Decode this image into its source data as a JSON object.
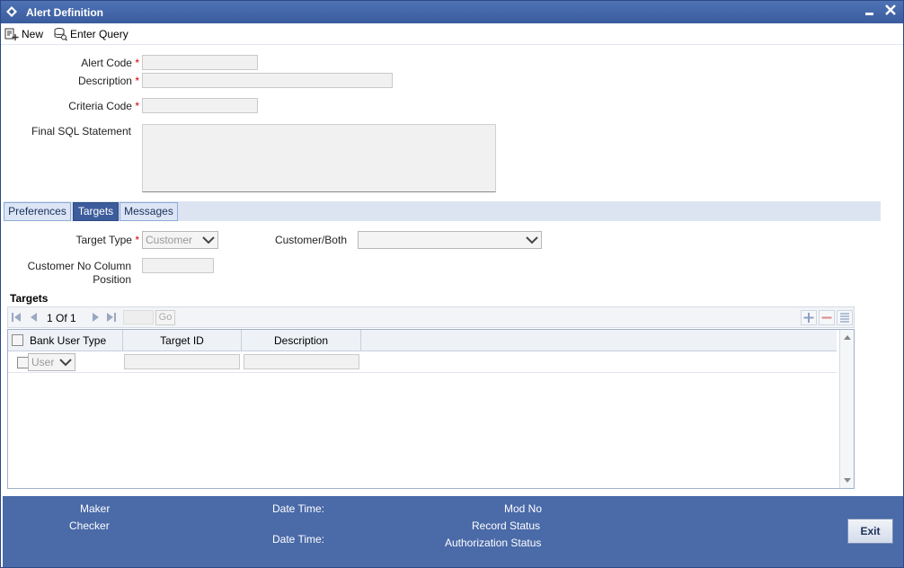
{
  "window": {
    "title": "Alert Definition"
  },
  "toolbar": {
    "new_label": "New",
    "enter_query_label": "Enter Query"
  },
  "form": {
    "alert_code_label": "Alert Code",
    "description_label": "Description",
    "criteria_code_label": "Criteria Code",
    "final_sql_label": "Final SQL Statement",
    "required_mark": "*"
  },
  "tabs": [
    {
      "label": "Preferences"
    },
    {
      "label": "Targets"
    },
    {
      "label": "Messages"
    }
  ],
  "targets_tab": {
    "target_type_label": "Target Type",
    "target_type_value": "Customer",
    "customer_both_label": "Customer/Both",
    "customer_both_value": "",
    "customer_no_column_label_1": "Customer No Column",
    "customer_no_column_label_2": "Position"
  },
  "targets_grid": {
    "section_title": "Targets",
    "pager_text": "1 Of 1",
    "go_label": "Go",
    "columns": [
      "Bank User Type",
      "Target ID",
      "Description"
    ],
    "rows": [
      {
        "bank_user_type": "User",
        "target_id": "",
        "description": ""
      }
    ]
  },
  "footer": {
    "maker_label": "Maker",
    "checker_label": "Checker",
    "date_time_label_1": "Date Time:",
    "date_time_label_2": "Date Time:",
    "mod_no_label": "Mod No",
    "record_status_label": "Record Status",
    "authorization_status_label": "Authorization Status",
    "exit_label": "Exit"
  },
  "colors": {
    "titlebar": "#3a5c9e",
    "footer": "#4a6aa8",
    "active_tab": "#3c5c9c",
    "required": "#cc0000"
  }
}
